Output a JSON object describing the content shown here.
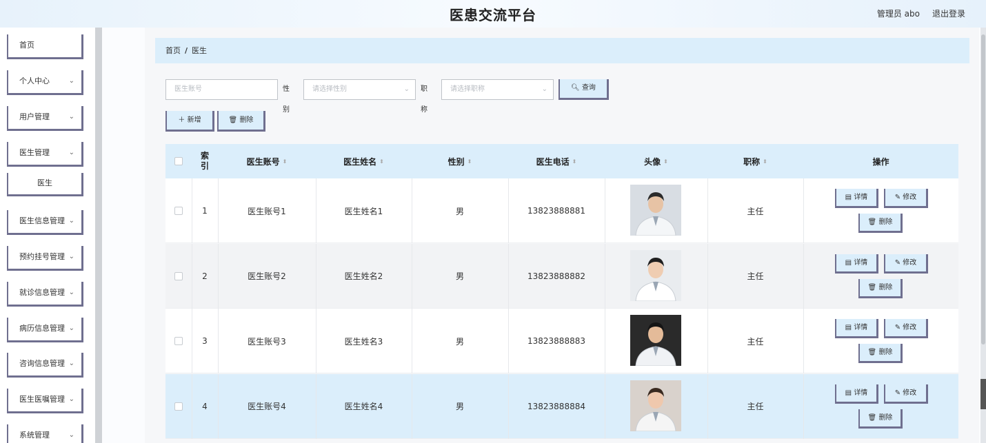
{
  "header": {
    "title": "医患交流平台",
    "user": "管理员 abo",
    "logout": "退出登录"
  },
  "sidebar": {
    "items": [
      {
        "label": "首页",
        "chev": ""
      },
      {
        "label": "个人中心",
        "chev": "⌄"
      },
      {
        "label": "用户管理",
        "chev": "⌄"
      },
      {
        "label": "医生管理",
        "chev": "⌄"
      },
      {
        "label": "医生信息管理",
        "chev": "⌄"
      },
      {
        "label": "预约挂号管理",
        "chev": "⌄"
      },
      {
        "label": "就诊信息管理",
        "chev": "⌄"
      },
      {
        "label": "病历信息管理",
        "chev": "⌄"
      },
      {
        "label": "咨询信息管理",
        "chev": "⌄"
      },
      {
        "label": "医生医嘱管理",
        "chev": "⌄"
      },
      {
        "label": "系统管理",
        "chev": "⌄"
      }
    ],
    "sub_item": "医生"
  },
  "breadcrumb": {
    "home": "首页",
    "sep": "/",
    "current": "医生"
  },
  "search": {
    "account_placeholder": "医生账号",
    "gender_label": "性别",
    "gender_placeholder": "请选择性别",
    "title_label": "职称",
    "title_placeholder": "请选择职称",
    "search_button": "查询"
  },
  "actions": {
    "add": "新增",
    "delete": "删除"
  },
  "table": {
    "headers": {
      "index": "索引",
      "account": "医生账号",
      "name": "医生姓名",
      "gender": "性别",
      "phone": "医生电话",
      "avatar": "头像",
      "title": "职称",
      "ops": "操作"
    },
    "rows": [
      {
        "index": "1",
        "account": "医生账号1",
        "name": "医生姓名1",
        "gender": "男",
        "phone": "13823888881",
        "title": "主任"
      },
      {
        "index": "2",
        "account": "医生账号2",
        "name": "医生姓名2",
        "gender": "男",
        "phone": "13823888882",
        "title": "主任"
      },
      {
        "index": "3",
        "account": "医生账号3",
        "name": "医生姓名3",
        "gender": "男",
        "phone": "13823888883",
        "title": "主任"
      },
      {
        "index": "4",
        "account": "医生账号4",
        "name": "医生姓名4",
        "gender": "男",
        "phone": "13823888884",
        "title": "主任"
      }
    ],
    "op_labels": {
      "detail": "详情",
      "edit": "修改",
      "delete": "删除"
    }
  },
  "colors": {
    "accent": "#dbeefb",
    "button_border": "#6f6f8f"
  }
}
